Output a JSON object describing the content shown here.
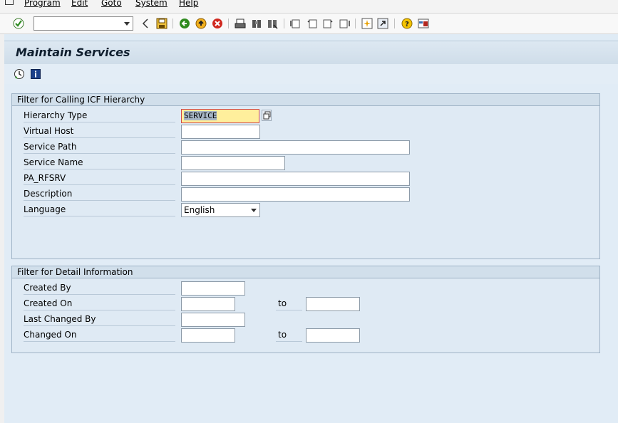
{
  "menubar": {
    "items": [
      "Program",
      "Edit",
      "Goto",
      "System",
      "Help"
    ]
  },
  "toolbar": {
    "command_field": ""
  },
  "title": "Maintain Services",
  "group1": {
    "title": "Filter for Calling ICF Hierarchy",
    "fields": [
      {
        "label": "Hierarchy Type",
        "value": "SERVICE"
      },
      {
        "label": "Virtual Host",
        "value": ""
      },
      {
        "label": "Service Path",
        "value": ""
      },
      {
        "label": "Service Name",
        "value": ""
      },
      {
        "label": "PA_RFSRV",
        "value": ""
      },
      {
        "label": "Description",
        "value": ""
      },
      {
        "label": "Language",
        "value": "English"
      }
    ]
  },
  "group2": {
    "title": "Filter for Detail Information",
    "fields": [
      {
        "label": "Created By",
        "value": ""
      },
      {
        "label": "Created On",
        "value": "",
        "to_label": "to",
        "to_value": ""
      },
      {
        "label": "Last Changed By",
        "value": ""
      },
      {
        "label": "Changed On",
        "value": "",
        "to_label": "to",
        "to_value": ""
      }
    ]
  }
}
